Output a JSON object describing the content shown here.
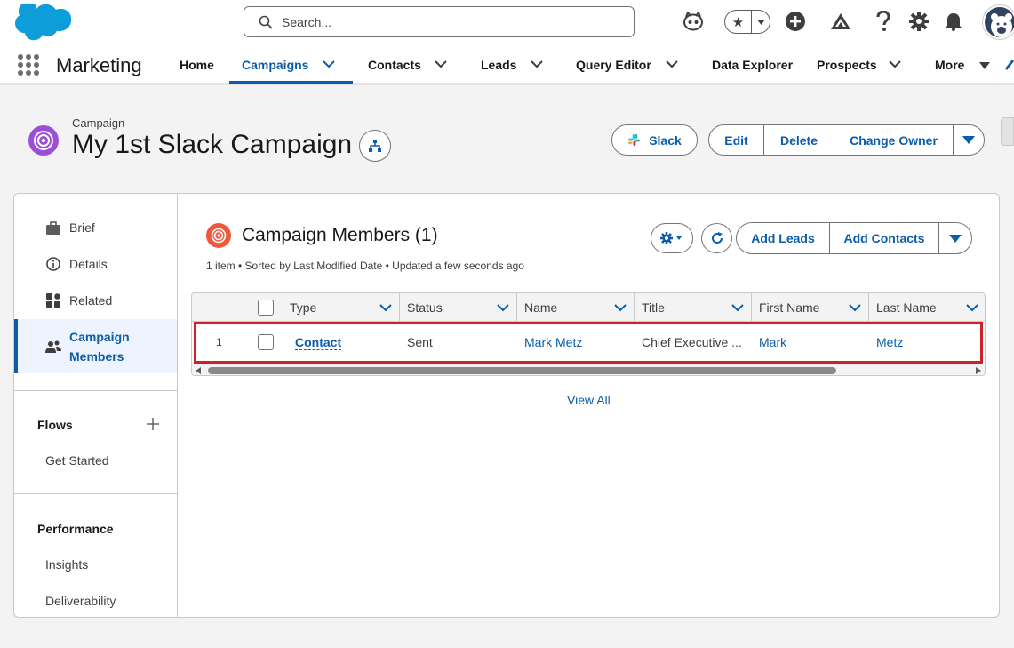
{
  "header": {
    "search_placeholder": "Search..."
  },
  "nav": {
    "app_name": "Marketing",
    "items": [
      {
        "label": "Home"
      },
      {
        "label": "Campaigns"
      },
      {
        "label": "Contacts"
      },
      {
        "label": "Leads"
      },
      {
        "label": "Query Editor"
      },
      {
        "label": "Data Explorer"
      },
      {
        "label": "Prospects"
      },
      {
        "label": "More"
      }
    ]
  },
  "record": {
    "type_label": "Campaign",
    "title": "My 1st Slack Campaign",
    "slack_button": "Slack",
    "actions": [
      "Edit",
      "Delete",
      "Change Owner"
    ]
  },
  "left_nav": {
    "items": [
      {
        "label": "Brief",
        "icon": "briefcase-icon"
      },
      {
        "label": "Details",
        "icon": "info-icon"
      },
      {
        "label": "Related",
        "icon": "related-grid-icon"
      },
      {
        "label": "Campaign\nMembers",
        "icon": "people-icon"
      }
    ],
    "flows_section": "Flows",
    "flows_items": [
      "Get Started"
    ],
    "performance_section": "Performance",
    "performance_items": [
      "Insights",
      "Deliverability"
    ]
  },
  "related_list": {
    "title": "Campaign Members (1)",
    "meta": "1 item • Sorted by Last Modified Date • Updated a few seconds ago",
    "buttons": {
      "add_leads": "Add Leads",
      "add_contacts": "Add Contacts"
    },
    "columns": [
      "Type",
      "Status",
      "Name",
      "Title",
      "First Name",
      "Last Name"
    ],
    "rows": [
      {
        "num": "1",
        "type": "Contact",
        "status": "Sent",
        "name": "Mark Metz",
        "title": "Chief Executive ...",
        "first_name": "Mark",
        "last_name": "Metz"
      }
    ],
    "view_all": "View All"
  },
  "colors": {
    "brand_blue": "#0b5cab",
    "campaign_purple": "#9b4fd8",
    "members_orange": "#f0573f",
    "highlight_red": "#d0212a"
  }
}
